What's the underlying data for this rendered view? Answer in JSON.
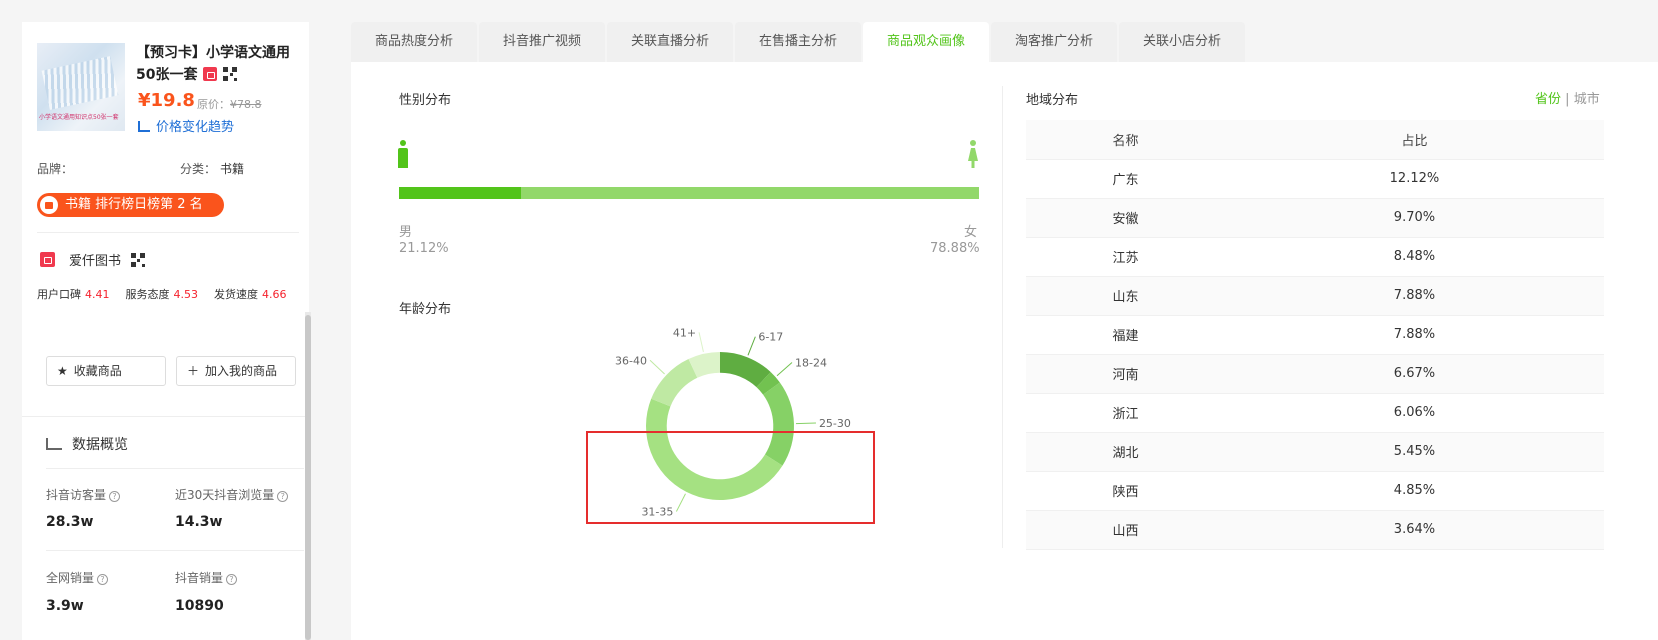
{
  "product": {
    "image_caption": "小学语文通用知识点50张一套",
    "title": "【预习卡】小学语文通用50张一套",
    "price": "¥19.8",
    "original_price_label": "原价：",
    "original_price": "¥78.8",
    "trend_link": "价格变化趋势",
    "brand_label": "品牌：",
    "category_label": "分类：",
    "category_value": "书籍",
    "rank_text": "书籍 排行榜日榜第 2 名",
    "shop_name": "爱仟图书",
    "scores": [
      {
        "label": "用户口碑",
        "value": "4.41"
      },
      {
        "label": "服务态度",
        "value": "4.53"
      },
      {
        "label": "发货速度",
        "value": "4.66"
      }
    ],
    "fav_button": "收藏商品",
    "add_button": "加入我的商品"
  },
  "overview": {
    "title": "数据概览",
    "stats": [
      {
        "label": "抖音访客量",
        "value": "28.3w"
      },
      {
        "label": "近30天抖音浏览量",
        "value": "14.3w"
      },
      {
        "label": "全网销量",
        "value": "3.9w"
      },
      {
        "label": "抖音销量",
        "value": "10890"
      }
    ]
  },
  "tabs": [
    {
      "label": "商品热度分析",
      "active": false
    },
    {
      "label": "抖音推广视频",
      "active": false
    },
    {
      "label": "关联直播分析",
      "active": false
    },
    {
      "label": "在售播主分析",
      "active": false
    },
    {
      "label": "商品观众画像",
      "active": true
    },
    {
      "label": "淘客推广分析",
      "active": false
    },
    {
      "label": "关联小店分析",
      "active": false
    }
  ],
  "gender": {
    "title": "性别分布",
    "male_label": "男",
    "female_label": "女",
    "male_pct": "21.12%",
    "female_pct": "78.88%",
    "male_fraction": 0.2112,
    "male_color": "#52c41a",
    "female_color": "#92d86a"
  },
  "age": {
    "title": "年龄分布"
  },
  "region": {
    "title": "地域分布",
    "switch_province": "省份",
    "switch_sep": "|",
    "switch_city": "城市",
    "headers": [
      "名称",
      "占比"
    ],
    "rows": [
      [
        "广东",
        "12.12%"
      ],
      [
        "安徽",
        "9.70%"
      ],
      [
        "江苏",
        "8.48%"
      ],
      [
        "山东",
        "7.88%"
      ],
      [
        "福建",
        "7.88%"
      ],
      [
        "河南",
        "6.67%"
      ],
      [
        "浙江",
        "6.06%"
      ],
      [
        "湖北",
        "5.45%"
      ],
      [
        "陕西",
        "4.85%"
      ],
      [
        "山西",
        "3.64%"
      ]
    ]
  },
  "chart_data": {
    "type": "pie",
    "title": "",
    "categories": [
      "6-17",
      "18-24",
      "25-30",
      "31-35",
      "36-40",
      "41+"
    ],
    "values": [
      12,
      3,
      19,
      47,
      12,
      7
    ],
    "colors": [
      "#5fad41",
      "#72c250",
      "#86d166",
      "#a5e182",
      "#bfe9a3",
      "#dcf3c9"
    ],
    "hole": 0.72
  }
}
